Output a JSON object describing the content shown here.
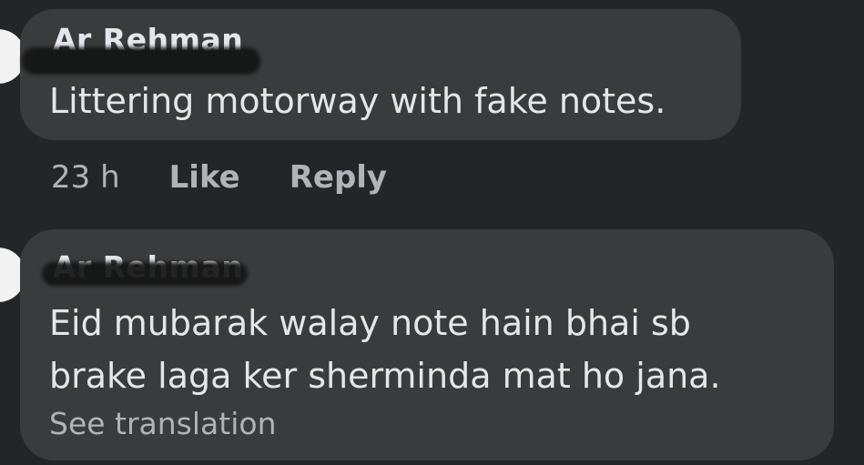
{
  "comments": [
    {
      "author": "Ar Rehman",
      "text_lines": [
        "Littering motorway with fake notes."
      ],
      "meta": {
        "time": "23 h",
        "like_label": "Like",
        "reply_label": "Reply"
      }
    },
    {
      "author": "Ar Rehman",
      "text_lines": [
        "Eid mubarak walay note hain bhai sb",
        "brake laga ker sherminda mat ho jana."
      ],
      "see_translation": "See translation"
    }
  ],
  "colors": {
    "background": "#242526",
    "bubble": "#3a3b3c",
    "primary_text": "#e4e6eb",
    "secondary_text": "#b0b3b8"
  }
}
